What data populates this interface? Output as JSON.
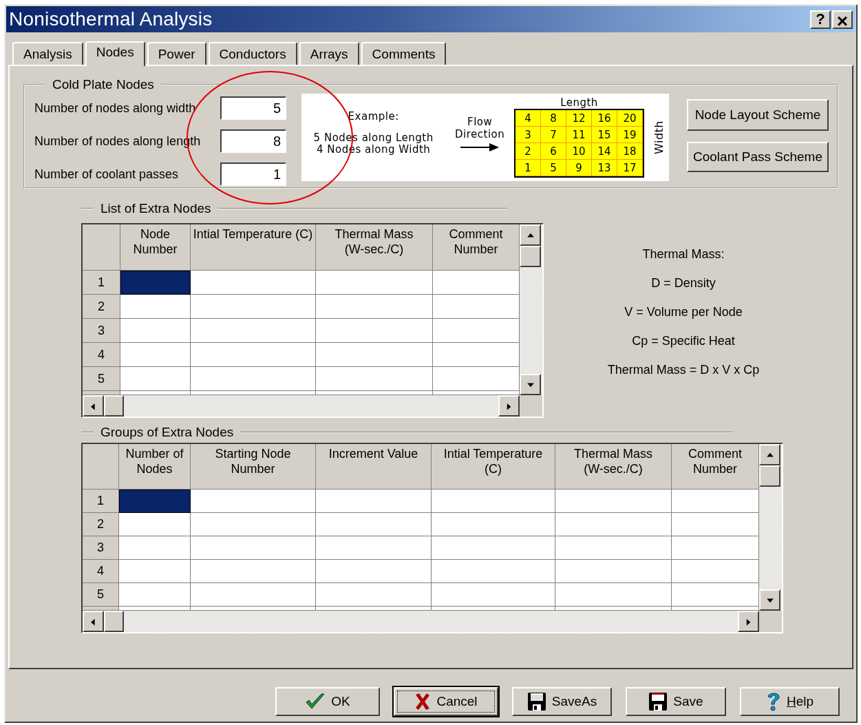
{
  "window": {
    "title": "Nonisothermal Analysis",
    "title_buttons": [
      {
        "kind": "help",
        "label": "?"
      },
      {
        "kind": "close",
        "label": "×"
      }
    ]
  },
  "tabs": [
    {
      "label": "Analysis",
      "selected": false
    },
    {
      "label": "Nodes",
      "selected": true
    },
    {
      "label": "Power",
      "selected": false
    },
    {
      "label": "Conductors",
      "selected": false
    },
    {
      "label": "Arrays",
      "selected": false
    },
    {
      "label": "Comments",
      "selected": false
    }
  ],
  "cold_plate_nodes": {
    "title": "Cold Plate Nodes",
    "fields": [
      {
        "label": "Number of nodes along width",
        "value": "5"
      },
      {
        "label": "Number of nodes along length",
        "value": "8"
      },
      {
        "label": "Number of coolant passes",
        "value": "1"
      }
    ],
    "example": {
      "heading": "Example:",
      "lines": [
        "5 Nodes along Length",
        "4 Nodes along Width"
      ],
      "flow_label": "Flow\nDirection",
      "length_label": "Length",
      "width_label": "Width",
      "grid": [
        [
          "4",
          "8",
          "12",
          "16",
          "20"
        ],
        [
          "3",
          "7",
          "11",
          "15",
          "19"
        ],
        [
          "2",
          "6",
          "10",
          "14",
          "18"
        ],
        [
          "1",
          "5",
          "9",
          "13",
          "17"
        ]
      ]
    },
    "buttons": [
      "Node Layout Scheme",
      "Coolant Pass Scheme"
    ]
  },
  "extra_nodes": {
    "title": "List of Extra Nodes",
    "columns": [
      "Node\nNumber",
      "Intial Temperature (C)",
      "Thermal Mass\n(W-sec./C)",
      "Comment\nNumber"
    ],
    "rows": [
      {
        "header": "1",
        "selected": true
      },
      {
        "header": "2",
        "selected": false
      },
      {
        "header": "3",
        "selected": false
      },
      {
        "header": "4",
        "selected": false
      },
      {
        "header": "5",
        "selected": false
      }
    ]
  },
  "thermal_mass_notes": [
    "Thermal Mass:",
    "D = Density",
    "V = Volume per Node",
    "Cp = Specific Heat",
    "Thermal Mass = D x V x Cp"
  ],
  "groups_of_extra_nodes": {
    "title": "Groups of Extra Nodes",
    "columns": [
      "Number of\nNodes",
      "Starting Node\nNumber",
      "Increment Value",
      "Intial Temperature\n(C)",
      "Thermal Mass\n(W-sec./C)",
      "Comment\nNumber"
    ],
    "rows": [
      {
        "header": "1",
        "selected": true
      },
      {
        "header": "2",
        "selected": false
      },
      {
        "header": "3",
        "selected": false
      },
      {
        "header": "4",
        "selected": false
      },
      {
        "header": "5",
        "selected": false
      }
    ]
  },
  "buttons": [
    {
      "kind": "ok",
      "label": "OK",
      "default": false,
      "underline_first": false
    },
    {
      "kind": "cancel",
      "label": "Cancel",
      "default": true,
      "underline_first": false
    },
    {
      "kind": "saveas",
      "label": "SaveAs",
      "default": false,
      "underline_first": false
    },
    {
      "kind": "save",
      "label": "Save",
      "default": false,
      "underline_first": false
    },
    {
      "kind": "help",
      "label": "Help",
      "default": false,
      "underline_first": true
    }
  ]
}
